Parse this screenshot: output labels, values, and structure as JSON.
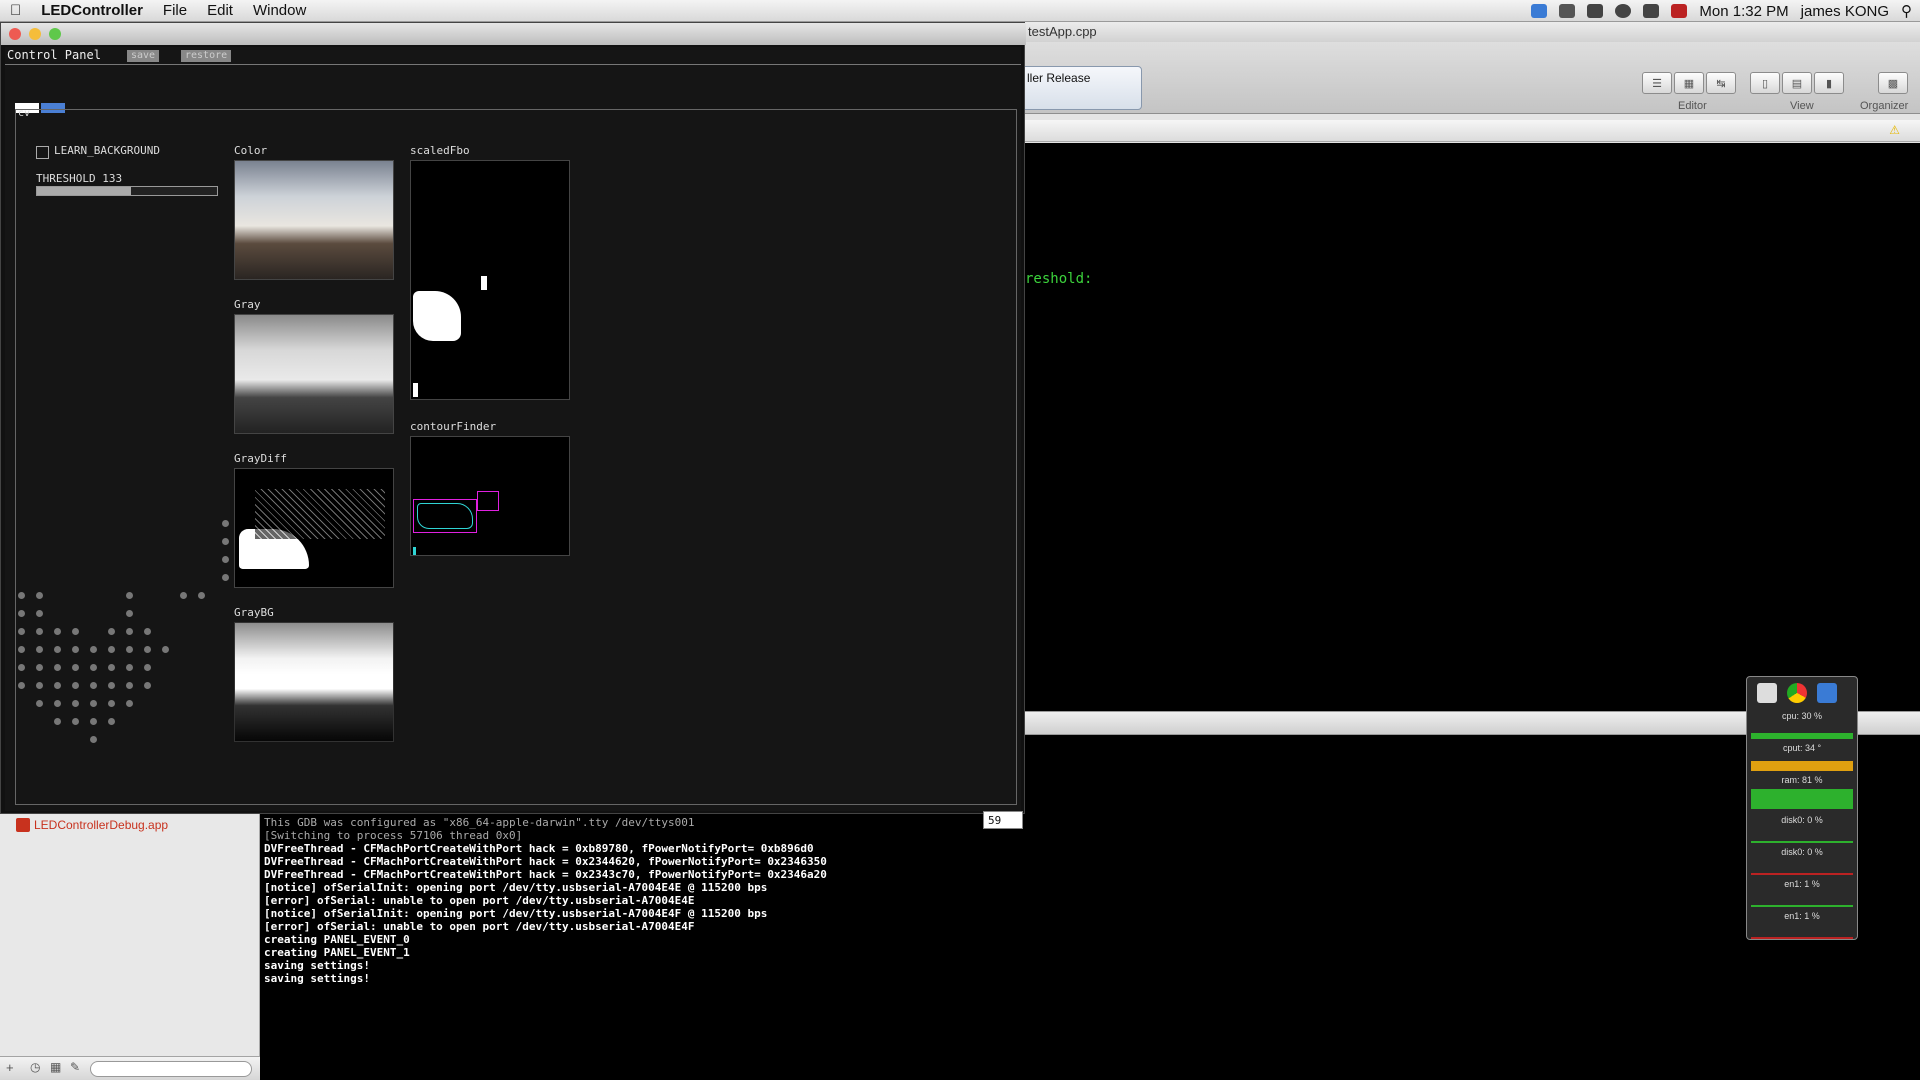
{
  "menubar": {
    "app_name": "LEDController",
    "menus": [
      "File",
      "Edit",
      "Window"
    ],
    "clock": "Mon 1:32 PM",
    "user": "james KONG"
  },
  "xcode": {
    "file_title": "testApp.cpp",
    "scheme_label": "ller Release",
    "toolbar_labels": {
      "editor": "Editor",
      "view": "View",
      "organizer": "Organizer"
    },
    "code_fragment": "reshold:"
  },
  "navigator": {
    "product": "LEDControllerDebug.app"
  },
  "console": {
    "lines": [
      "This GDB was configured as \"x86_64-apple-darwin\".tty /dev/ttys001",
      "[Switching to process 57106 thread 0x0]",
      "DVFreeThread - CFMachPortCreateWithPort hack = 0xb89780, fPowerNotifyPort= 0xb896d0",
      "DVFreeThread - CFMachPortCreateWithPort hack = 0x2344620, fPowerNotifyPort= 0x2346350",
      "DVFreeThread - CFMachPortCreateWithPort hack = 0x2343c70, fPowerNotifyPort= 0x2346a20",
      "[notice] ofSerialInit: opening port /dev/tty.usbserial-A7004E4E @ 115200 bps",
      "[error] ofSerial: unable to open port /dev/tty.usbserial-A7004E4E",
      "[notice] ofSerialInit: opening port /dev/tty.usbserial-A7004E4F @ 115200 bps",
      "[error] ofSerial: unable to open port /dev/tty.usbserial-A7004E4F",
      "creating PANEL_EVENT_0",
      "creating PANEL_EVENT_1",
      "saving settings!",
      "saving settings!"
    ]
  },
  "control_panel": {
    "title": "Control Panel",
    "save_label": "save",
    "restore_label": "restore",
    "panel_name": "cv",
    "learn_background_label": "LEARN_BACKGROUND",
    "learn_background_checked": false,
    "threshold_label": "THRESHOLD 133",
    "threshold_value": 133,
    "threshold_fraction": 0.52,
    "images": {
      "color": "Color",
      "gray": "Gray",
      "graydiff": "GrayDiff",
      "graybg": "GrayBG",
      "scaled": "scaledFbo",
      "contour": "contourFinder"
    },
    "fps": "59"
  },
  "monitor": {
    "cpu": "cpu: 30 %",
    "cput": "cput: 34 °",
    "ram": "ram: 81 %",
    "disk0a": "disk0: 0 %",
    "disk0b": "disk0: 0 %",
    "en1a": "en1: 1 %",
    "en1b": "en1: 1 %"
  }
}
